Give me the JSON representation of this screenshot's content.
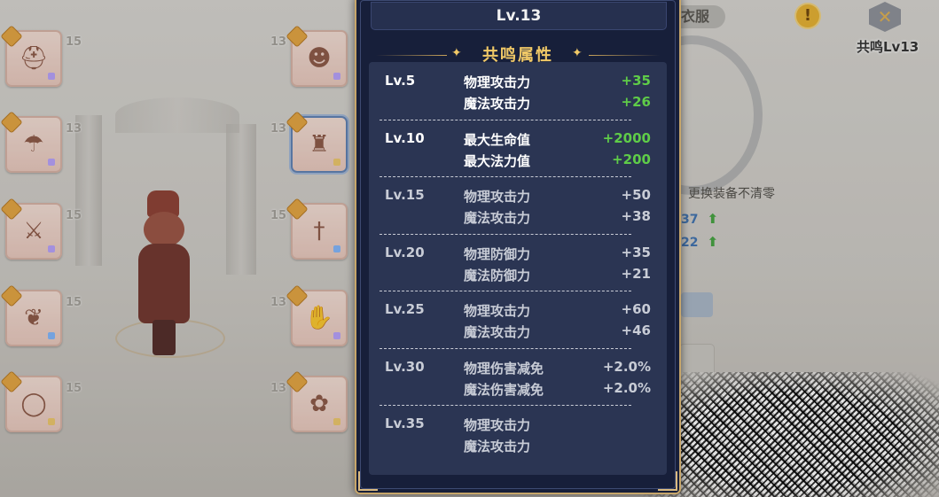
{
  "panel": {
    "level": "Lv.13",
    "section_title": "共鸣属性",
    "tiers": [
      {
        "level": "Lv.5",
        "active": true,
        "stats": [
          {
            "name": "物理攻击力",
            "value": "+35"
          },
          {
            "name": "魔法攻击力",
            "value": "+26"
          }
        ]
      },
      {
        "level": "Lv.10",
        "active": true,
        "stats": [
          {
            "name": "最大生命值",
            "value": "+2000"
          },
          {
            "name": "最大法力值",
            "value": "+200"
          }
        ]
      },
      {
        "level": "Lv.15",
        "active": false,
        "stats": [
          {
            "name": "物理攻击力",
            "value": "+50"
          },
          {
            "name": "魔法攻击力",
            "value": "+38"
          }
        ]
      },
      {
        "level": "Lv.20",
        "active": false,
        "stats": [
          {
            "name": "物理防御力",
            "value": "+35"
          },
          {
            "name": "魔法防御力",
            "value": "+21"
          }
        ]
      },
      {
        "level": "Lv.25",
        "active": false,
        "stats": [
          {
            "name": "物理攻击力",
            "value": "+60"
          },
          {
            "name": "魔法攻击力",
            "value": "+46"
          }
        ]
      },
      {
        "level": "Lv.30",
        "active": false,
        "stats": [
          {
            "name": "物理伤害减免",
            "value": "+2.0%"
          },
          {
            "name": "魔法伤害减免",
            "value": "+2.0%"
          }
        ]
      },
      {
        "level": "Lv.35",
        "active": false,
        "stats": [
          {
            "name": "物理攻击力",
            "value": ""
          },
          {
            "name": "魔法攻击力",
            "value": ""
          }
        ]
      }
    ]
  },
  "equipment": {
    "left_slots": [
      {
        "level": "15",
        "icon": "helmet-icon"
      },
      {
        "level": "13",
        "icon": "hair-icon"
      },
      {
        "level": "15",
        "icon": "sword-icon"
      },
      {
        "level": "15",
        "icon": "cape-icon"
      },
      {
        "level": "15",
        "icon": "ring-icon"
      }
    ],
    "right_slots": [
      {
        "level": "13",
        "icon": "mask-icon"
      },
      {
        "level": "13",
        "icon": "armor-icon"
      },
      {
        "level": "15",
        "icon": "dagger-icon"
      },
      {
        "level": "13",
        "icon": "glove-icon"
      },
      {
        "level": "13",
        "icon": "amulet-icon"
      }
    ]
  },
  "right_panel": {
    "tab_label": "衣服",
    "warn_symbol": "!",
    "resonance_label": "共鸣Lv13",
    "note": "更换装备不清零",
    "stat_values": [
      "37",
      "22"
    ]
  },
  "colors": {
    "panel_bg": "#171f3a",
    "active_value": "#5fcc48",
    "title_gold": "#f1c967"
  }
}
